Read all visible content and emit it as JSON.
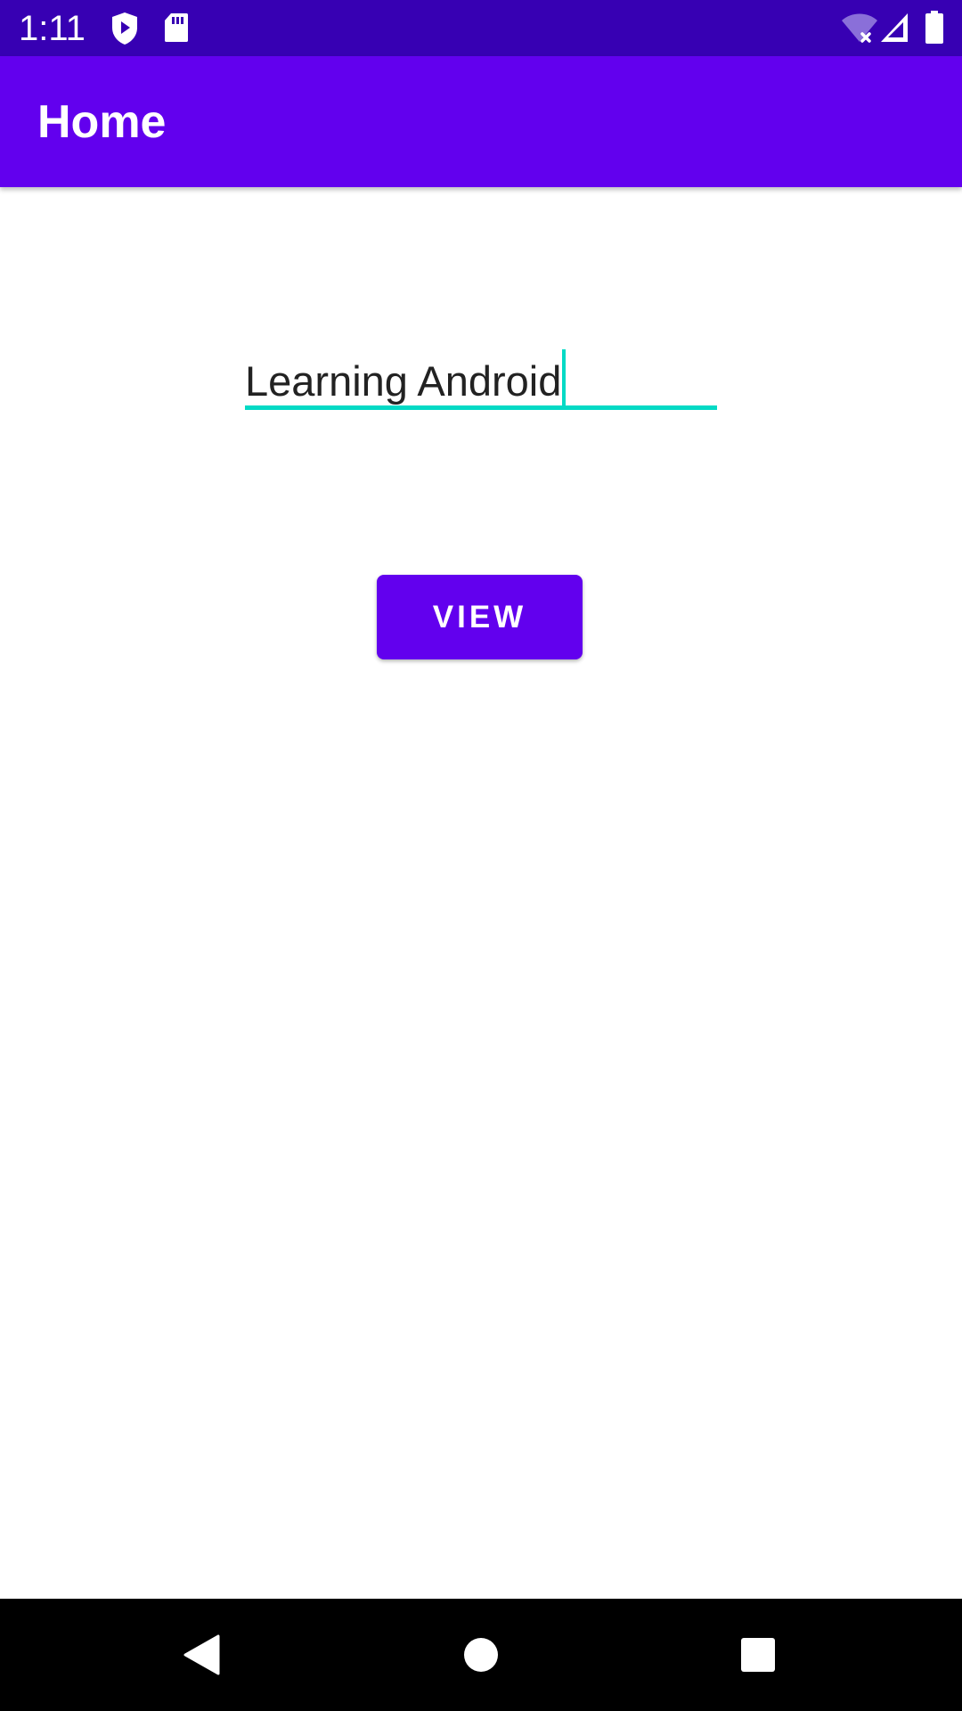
{
  "status_bar": {
    "time": "1:11",
    "icons": [
      "shield-play-icon",
      "sd-card-icon",
      "wifi-off-icon",
      "cell-signal-icon",
      "battery-icon"
    ],
    "background": "#3700b3"
  },
  "app_bar": {
    "title": "Home",
    "background": "#6200ee"
  },
  "main": {
    "text_input": {
      "value": "Learning Android",
      "focused": true,
      "accent": "#03dac5"
    },
    "view_button": {
      "label": "VIEW",
      "background": "#6200ee"
    }
  },
  "nav_bar": {
    "buttons": [
      "back-icon",
      "home-icon",
      "recents-icon"
    ]
  }
}
